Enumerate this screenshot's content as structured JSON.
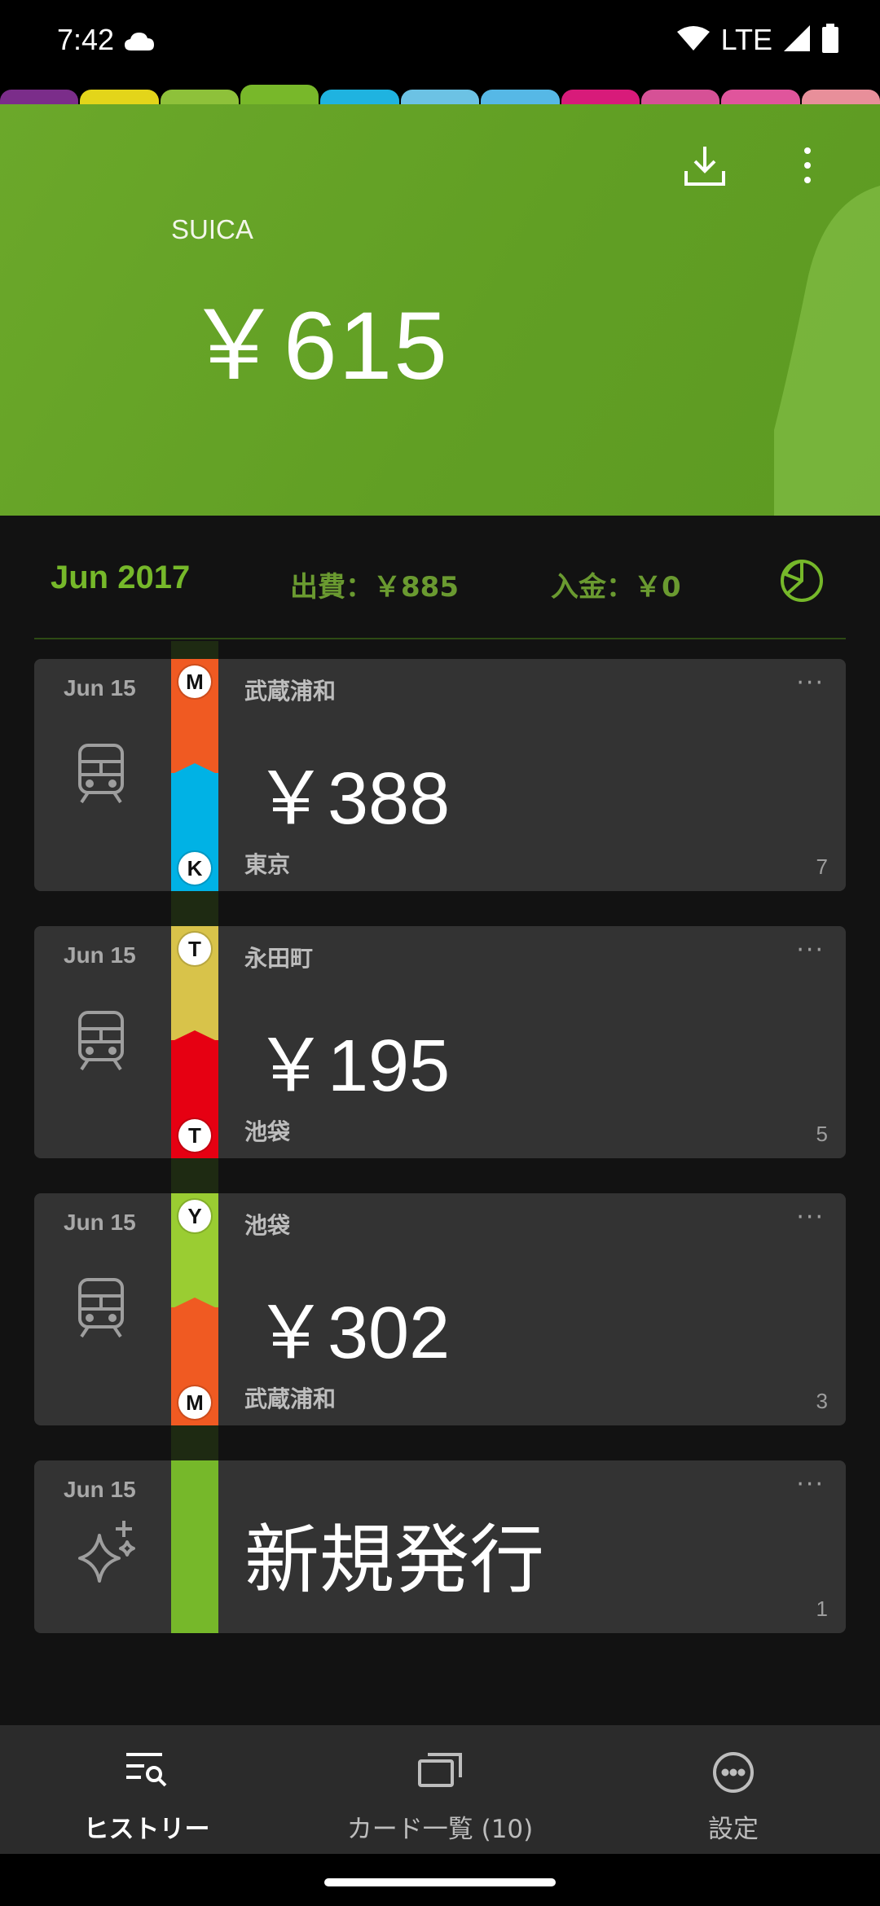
{
  "status_bar": {
    "time": "7:42",
    "network": "LTE"
  },
  "tab_colors": [
    "#7b2d8a",
    "#e3d51a",
    "#8ec13a",
    "#78b82a",
    "#1fb3e0",
    "#6cc2e4",
    "#56b8e6",
    "#d81b7a",
    "#d65196",
    "#e0559c",
    "#e88f9a"
  ],
  "card": {
    "name": "SUICA",
    "balance": "￥615",
    "color": "#67a52a"
  },
  "summary": {
    "month": "Jun 2017",
    "expense": "出費：￥885",
    "income": "入金：￥0"
  },
  "transactions": [
    {
      "date": "Jun 15",
      "from": "武蔵浦和",
      "to": "東京",
      "amount": "￥388",
      "count": "7",
      "from_badge": "M",
      "to_badge": "K",
      "from_color": "#f05a22",
      "to_color": "#00b2e5",
      "icon": "train-icon"
    },
    {
      "date": "Jun 15",
      "from": "永田町",
      "to": "池袋",
      "amount": "￥195",
      "count": "5",
      "from_badge": "T",
      "to_badge": "T",
      "from_color": "#d8c34a",
      "to_color": "#e60012",
      "icon": "train-icon"
    },
    {
      "date": "Jun 15",
      "from": "池袋",
      "to": "武蔵浦和",
      "amount": "￥302",
      "count": "3",
      "from_badge": "Y",
      "to_badge": "M",
      "from_color": "#9acd32",
      "to_color": "#f05a22",
      "icon": "train-icon"
    },
    {
      "date": "Jun 15",
      "label": "新規発行",
      "count": "1",
      "color": "#76b82a",
      "icon": "sparkle-icon"
    }
  ],
  "more_glyph": "···",
  "bottom_nav": [
    {
      "label": "ヒストリー",
      "icon": "history-search-icon",
      "active": true
    },
    {
      "label": "カード一覧 (10)",
      "icon": "cards-icon",
      "active": false
    },
    {
      "label": "設定",
      "icon": "more-circle-icon",
      "active": false
    }
  ]
}
